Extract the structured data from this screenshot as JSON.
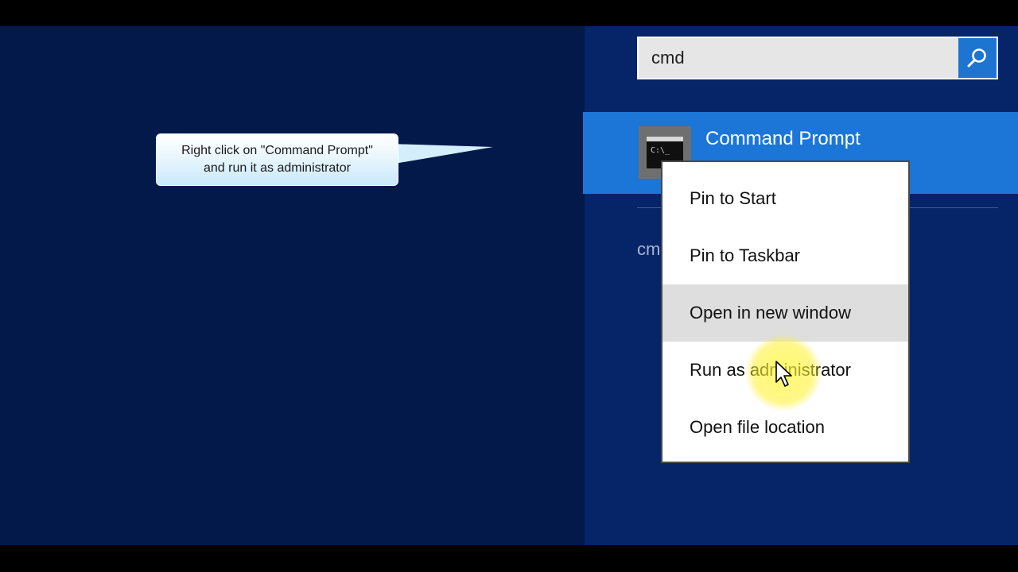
{
  "callout": {
    "line1": "Right click on \"Command Prompt\"",
    "line2": "and run it as administrator"
  },
  "search": {
    "value": "cmd",
    "button_icon": "search-icon"
  },
  "result": {
    "label": "Command Prompt",
    "icon": "command-prompt-icon",
    "icon_text": "C:\\_"
  },
  "partial_result": {
    "label": "cm"
  },
  "context_menu": {
    "items": [
      {
        "label": "Pin to Start"
      },
      {
        "label": "Pin to Taskbar"
      },
      {
        "label": "Open in new window"
      },
      {
        "label": "Run as administrator"
      },
      {
        "label": "Open file location"
      }
    ],
    "hovered_index": 2
  },
  "colors": {
    "background": "#03194a",
    "right_pane": "#062468",
    "accent": "#1b76d8",
    "search_button": "#1d75d1",
    "cursor_highlight": "#fff83c"
  }
}
